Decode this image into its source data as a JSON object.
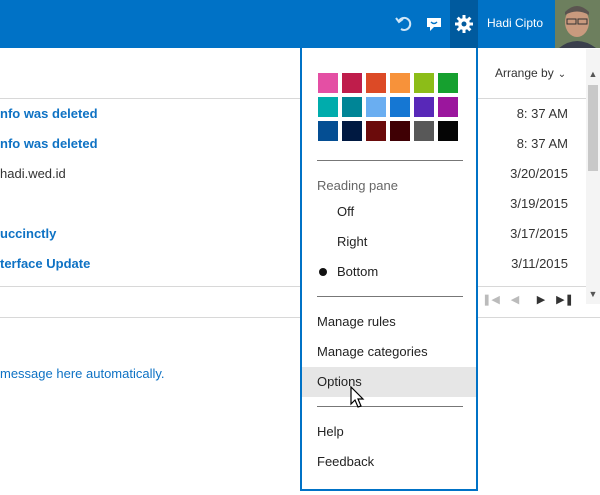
{
  "topbar": {
    "undo_icon": "undo-icon",
    "chat_icon": "feedback-chat-icon",
    "settings_icon": "gear-icon",
    "user_name": "Hadi Cipto",
    "accent_color": "#0072c6"
  },
  "list": {
    "arrange_label": "Arrange by",
    "messages": [
      {
        "subject": "nfo was deleted",
        "date": "8: 37 AM",
        "unread": true
      },
      {
        "subject": "nfo was deleted",
        "date": "8: 37 AM",
        "unread": true
      },
      {
        "subject": "hadi.wed.id",
        "date": "3/20/2015",
        "unread": false
      },
      {
        "subject": "",
        "date": "3/19/2015",
        "unread": false
      },
      {
        "subject": "uccinctly",
        "date": "3/17/2015",
        "unread": true
      },
      {
        "subject": "terface Update",
        "date": "3/11/2015",
        "unread": true
      }
    ]
  },
  "reading_pane": {
    "text": "message here automatically."
  },
  "settings_menu": {
    "theme_colors": [
      "#e44fa4",
      "#bf1d4b",
      "#dc4a26",
      "#f7923a",
      "#8cbd18",
      "#16a02f",
      "#00acac",
      "#008596",
      "#6aaef1",
      "#1577d3",
      "#5828b8",
      "#9b169d",
      "#044e93",
      "#001941",
      "#6b0b0b",
      "#3f0004",
      "#585858",
      "#050505"
    ],
    "reading_pane_label": "Reading pane",
    "reading_pane_options": [
      {
        "label": "Off",
        "selected": false
      },
      {
        "label": "Right",
        "selected": false
      },
      {
        "label": "Bottom",
        "selected": true
      }
    ],
    "items": [
      "Manage rules",
      "Manage categories",
      "Options"
    ],
    "footer_items": [
      "Help",
      "Feedback"
    ]
  }
}
